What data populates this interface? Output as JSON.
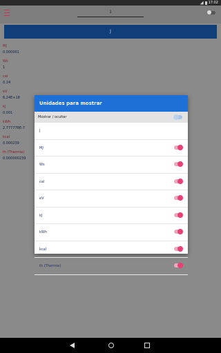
{
  "status": {
    "time": "17:02"
  },
  "app": {
    "quantity_value": "1",
    "unit_selected": "J",
    "results": [
      {
        "unit": "MJ",
        "value": "0.000001"
      },
      {
        "unit": "Ws",
        "value": "1"
      },
      {
        "unit": "cal",
        "value": "0.24"
      },
      {
        "unit": "eV",
        "value": "6.24E+18"
      },
      {
        "unit": "kJ",
        "value": "0.001"
      },
      {
        "unit": "kWh",
        "value": "2.777778E-7"
      },
      {
        "unit": "kcal",
        "value": "0.000239"
      },
      {
        "unit": "th (Thermie)",
        "value": "0.000000239"
      }
    ]
  },
  "dialog": {
    "title": "Unidades para mostrar",
    "subheader": "Mostrar / ocultar",
    "units": [
      {
        "label": "J",
        "enabled": false
      },
      {
        "label": "MJ",
        "enabled": true
      },
      {
        "label": "Ws",
        "enabled": true
      },
      {
        "label": "cal",
        "enabled": true
      },
      {
        "label": "eV",
        "enabled": true
      },
      {
        "label": "kJ",
        "enabled": true
      },
      {
        "label": "kWh",
        "enabled": true
      },
      {
        "label": "kcal",
        "enabled": true
      },
      {
        "label": "th (Thermie)",
        "enabled": true
      }
    ]
  },
  "colors": {
    "accent": "#1e6fd6",
    "toggle_on": "#ea3f73",
    "unit_bar": "#0f3e78"
  }
}
